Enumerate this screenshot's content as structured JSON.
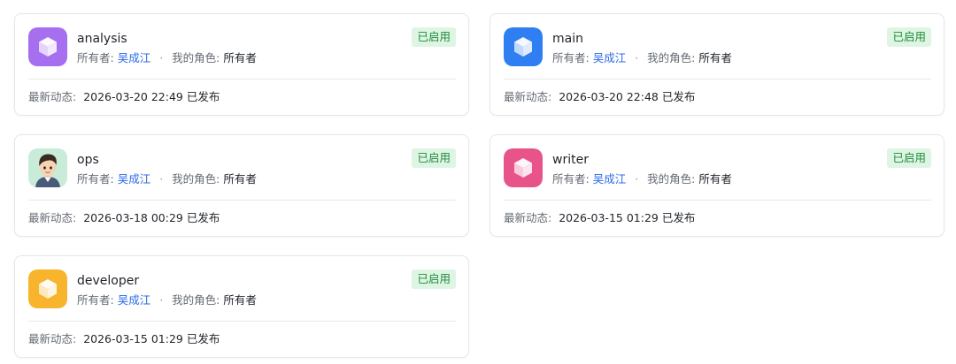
{
  "agents": [
    {
      "name": "analysis",
      "owner_label": "所有者:",
      "owner": "吴成江",
      "separator": "·",
      "role_label": "我的角色:",
      "role": "所有者",
      "status": "已启用",
      "activity_label": "最新动态:",
      "activity": "2026-03-20 22:49 已发布",
      "icon": "cube-icon",
      "icon_color": "#a56ff0"
    },
    {
      "name": "main",
      "owner_label": "所有者:",
      "owner": "吴成江",
      "separator": "·",
      "role_label": "我的角色:",
      "role": "所有者",
      "status": "已启用",
      "activity_label": "最新动态:",
      "activity": "2026-03-20 22:48 已发布",
      "icon": "cube-icon",
      "icon_color": "#2f7ff2"
    },
    {
      "name": "ops",
      "owner_label": "所有者:",
      "owner": "吴成江",
      "separator": "·",
      "role_label": "我的角色:",
      "role": "所有者",
      "status": "已启用",
      "activity_label": "最新动态:",
      "activity": "2026-03-18 00:29 已发布",
      "icon": "person-avatar-icon",
      "icon_color": "#c9ecd8"
    },
    {
      "name": "writer",
      "owner_label": "所有者:",
      "owner": "吴成江",
      "separator": "·",
      "role_label": "我的角色:",
      "role": "所有者",
      "status": "已启用",
      "activity_label": "最新动态:",
      "activity": "2026-03-15 01:29 已发布",
      "icon": "cube-icon",
      "icon_color": "#e8548a"
    },
    {
      "name": "developer",
      "owner_label": "所有者:",
      "owner": "吴成江",
      "separator": "·",
      "role_label": "我的角色:",
      "role": "所有者",
      "status": "已启用",
      "activity_label": "最新动态:",
      "activity": "2026-03-15 01:29 已发布",
      "icon": "cube-icon",
      "icon_color": "#f7b42c"
    }
  ],
  "colors": {
    "status_bg": "#dff5e4",
    "status_text": "#1f8a3b",
    "link": "#2b6ce8"
  }
}
